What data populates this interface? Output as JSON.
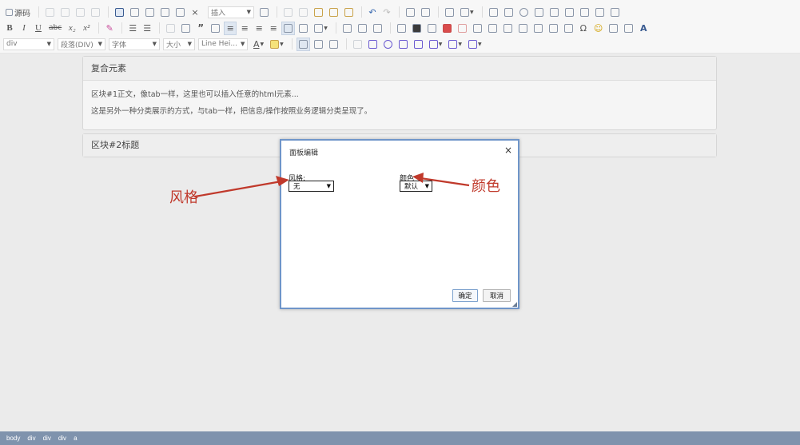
{
  "toolbar": {
    "source_label": "源码",
    "insert_label": "插入",
    "format_block_label": "div",
    "paragraph_label": "段落(DIV)",
    "font_label": "字体",
    "size_label": "大小",
    "line_height_label": "Line Hei...",
    "bold": "B",
    "italic": "I",
    "underline": "U",
    "strike": "abc",
    "subscript": "x₂",
    "superscript": "x²",
    "quote": "”",
    "omega": "Ω",
    "smiley": "☺"
  },
  "panels": [
    {
      "title": "复合元素",
      "lines": [
        "区块#1正文，像tab一样，这里也可以插入任意的html元素...",
        "这是另外一种分类展示的方式，与tab一样，把信息/操作按照业务逻辑分类呈现了。"
      ]
    },
    {
      "title": "区块#2标题"
    }
  ],
  "dialog": {
    "title": "面板编辑",
    "close": "×",
    "style_label": "风格:",
    "style_value": "无",
    "color_label": "颜色",
    "color_value": "默认",
    "confirm": "确定",
    "cancel": "取消"
  },
  "annotations": {
    "style": "风格",
    "color": "颜色"
  },
  "statusbar": {
    "path": [
      "body",
      "div",
      "div",
      "div",
      "a"
    ]
  },
  "colors": {
    "annotation_red": "#c0392b",
    "dialog_border": "#6f95c9",
    "statusbar_bg": "#7f93ad"
  }
}
